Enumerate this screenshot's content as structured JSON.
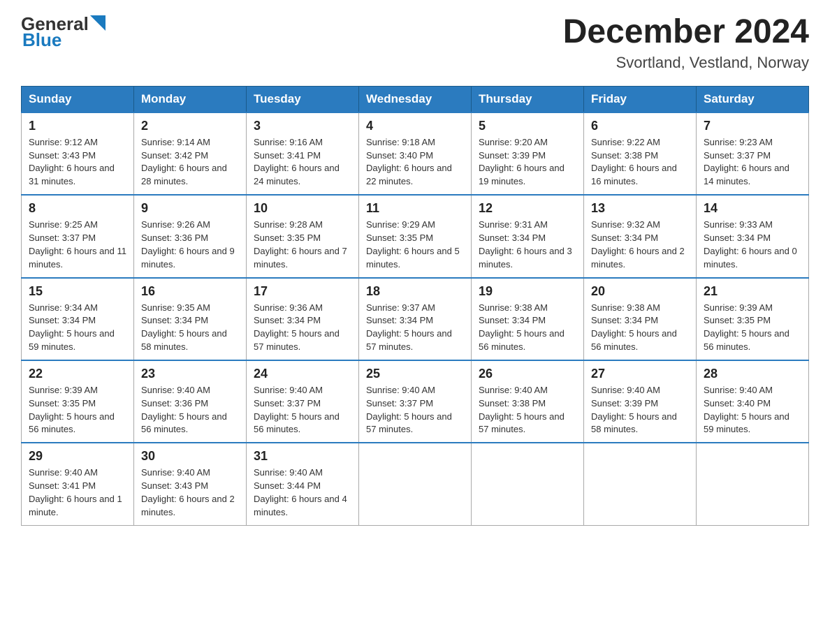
{
  "header": {
    "logo_general": "General",
    "logo_blue": "Blue",
    "month_title": "December 2024",
    "location": "Svortland, Vestland, Norway"
  },
  "days_of_week": [
    "Sunday",
    "Monday",
    "Tuesday",
    "Wednesday",
    "Thursday",
    "Friday",
    "Saturday"
  ],
  "weeks": [
    [
      {
        "day": "1",
        "sunrise": "9:12 AM",
        "sunset": "3:43 PM",
        "daylight": "6 hours and 31 minutes."
      },
      {
        "day": "2",
        "sunrise": "9:14 AM",
        "sunset": "3:42 PM",
        "daylight": "6 hours and 28 minutes."
      },
      {
        "day": "3",
        "sunrise": "9:16 AM",
        "sunset": "3:41 PM",
        "daylight": "6 hours and 24 minutes."
      },
      {
        "day": "4",
        "sunrise": "9:18 AM",
        "sunset": "3:40 PM",
        "daylight": "6 hours and 22 minutes."
      },
      {
        "day": "5",
        "sunrise": "9:20 AM",
        "sunset": "3:39 PM",
        "daylight": "6 hours and 19 minutes."
      },
      {
        "day": "6",
        "sunrise": "9:22 AM",
        "sunset": "3:38 PM",
        "daylight": "6 hours and 16 minutes."
      },
      {
        "day": "7",
        "sunrise": "9:23 AM",
        "sunset": "3:37 PM",
        "daylight": "6 hours and 14 minutes."
      }
    ],
    [
      {
        "day": "8",
        "sunrise": "9:25 AM",
        "sunset": "3:37 PM",
        "daylight": "6 hours and 11 minutes."
      },
      {
        "day": "9",
        "sunrise": "9:26 AM",
        "sunset": "3:36 PM",
        "daylight": "6 hours and 9 minutes."
      },
      {
        "day": "10",
        "sunrise": "9:28 AM",
        "sunset": "3:35 PM",
        "daylight": "6 hours and 7 minutes."
      },
      {
        "day": "11",
        "sunrise": "9:29 AM",
        "sunset": "3:35 PM",
        "daylight": "6 hours and 5 minutes."
      },
      {
        "day": "12",
        "sunrise": "9:31 AM",
        "sunset": "3:34 PM",
        "daylight": "6 hours and 3 minutes."
      },
      {
        "day": "13",
        "sunrise": "9:32 AM",
        "sunset": "3:34 PM",
        "daylight": "6 hours and 2 minutes."
      },
      {
        "day": "14",
        "sunrise": "9:33 AM",
        "sunset": "3:34 PM",
        "daylight": "6 hours and 0 minutes."
      }
    ],
    [
      {
        "day": "15",
        "sunrise": "9:34 AM",
        "sunset": "3:34 PM",
        "daylight": "5 hours and 59 minutes."
      },
      {
        "day": "16",
        "sunrise": "9:35 AM",
        "sunset": "3:34 PM",
        "daylight": "5 hours and 58 minutes."
      },
      {
        "day": "17",
        "sunrise": "9:36 AM",
        "sunset": "3:34 PM",
        "daylight": "5 hours and 57 minutes."
      },
      {
        "day": "18",
        "sunrise": "9:37 AM",
        "sunset": "3:34 PM",
        "daylight": "5 hours and 57 minutes."
      },
      {
        "day": "19",
        "sunrise": "9:38 AM",
        "sunset": "3:34 PM",
        "daylight": "5 hours and 56 minutes."
      },
      {
        "day": "20",
        "sunrise": "9:38 AM",
        "sunset": "3:34 PM",
        "daylight": "5 hours and 56 minutes."
      },
      {
        "day": "21",
        "sunrise": "9:39 AM",
        "sunset": "3:35 PM",
        "daylight": "5 hours and 56 minutes."
      }
    ],
    [
      {
        "day": "22",
        "sunrise": "9:39 AM",
        "sunset": "3:35 PM",
        "daylight": "5 hours and 56 minutes."
      },
      {
        "day": "23",
        "sunrise": "9:40 AM",
        "sunset": "3:36 PM",
        "daylight": "5 hours and 56 minutes."
      },
      {
        "day": "24",
        "sunrise": "9:40 AM",
        "sunset": "3:37 PM",
        "daylight": "5 hours and 56 minutes."
      },
      {
        "day": "25",
        "sunrise": "9:40 AM",
        "sunset": "3:37 PM",
        "daylight": "5 hours and 57 minutes."
      },
      {
        "day": "26",
        "sunrise": "9:40 AM",
        "sunset": "3:38 PM",
        "daylight": "5 hours and 57 minutes."
      },
      {
        "day": "27",
        "sunrise": "9:40 AM",
        "sunset": "3:39 PM",
        "daylight": "5 hours and 58 minutes."
      },
      {
        "day": "28",
        "sunrise": "9:40 AM",
        "sunset": "3:40 PM",
        "daylight": "5 hours and 59 minutes."
      }
    ],
    [
      {
        "day": "29",
        "sunrise": "9:40 AM",
        "sunset": "3:41 PM",
        "daylight": "6 hours and 1 minute."
      },
      {
        "day": "30",
        "sunrise": "9:40 AM",
        "sunset": "3:43 PM",
        "daylight": "6 hours and 2 minutes."
      },
      {
        "day": "31",
        "sunrise": "9:40 AM",
        "sunset": "3:44 PM",
        "daylight": "6 hours and 4 minutes."
      },
      null,
      null,
      null,
      null
    ]
  ],
  "labels": {
    "sunrise": "Sunrise:",
    "sunset": "Sunset:",
    "daylight": "Daylight:"
  }
}
